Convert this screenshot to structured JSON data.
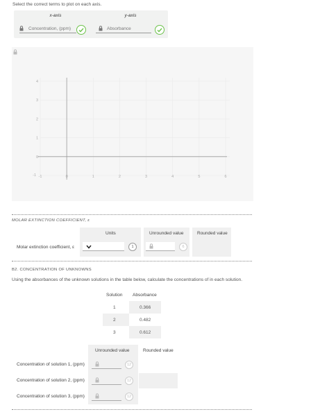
{
  "instruction": "Select the correct terms to plot on each axis.",
  "axis_select": {
    "x_head": "x-axis",
    "y_head": "y-axis",
    "x_value": "Concentration, (ppm)",
    "y_value": "Absorbance"
  },
  "chart_data": {
    "type": "scatter",
    "x_ticks": [
      "-1",
      "0",
      "1",
      "2",
      "3",
      "4",
      "5",
      "6"
    ],
    "y_ticks": [
      "-1",
      "0",
      "1",
      "2",
      "3",
      "4"
    ],
    "xlim": [
      -1,
      6
    ],
    "ylim": [
      -1,
      4
    ],
    "points": [],
    "grid": true
  },
  "molar": {
    "heading": "MOLAR EXTINCTION COEFFICIENT, ε",
    "units_head": "Units",
    "unrounded_head": "Unrounded value",
    "rounded_head": "Rounded value",
    "row_label": "Molar extinction coefficient, ε",
    "units_badge": "1",
    "sig_badge": "6"
  },
  "b2": {
    "heading": "B2. CONCENTRATION OF UNKNOWNS",
    "instruction": "Using the absorbances of the unknown solutions in the table below, calculate the concentrations of in each solution.",
    "table_head": [
      "Solution",
      "Absorbance"
    ],
    "rows": [
      {
        "solution": "1",
        "absorbance": "0.366"
      },
      {
        "solution": "2",
        "absorbance": "0.482"
      },
      {
        "solution": "3",
        "absorbance": "0.612"
      }
    ],
    "unrounded_head": "Unrounded value",
    "rounded_head": "Rounded value",
    "conc_rows": [
      {
        "label": "Concentration of solution 1, (ppm)",
        "badge": "12"
      },
      {
        "label": "Concentration of solution 2, (ppm)",
        "badge": "12"
      },
      {
        "label": "Concentration of solution 3, (ppm)",
        "badge": "12"
      }
    ]
  }
}
